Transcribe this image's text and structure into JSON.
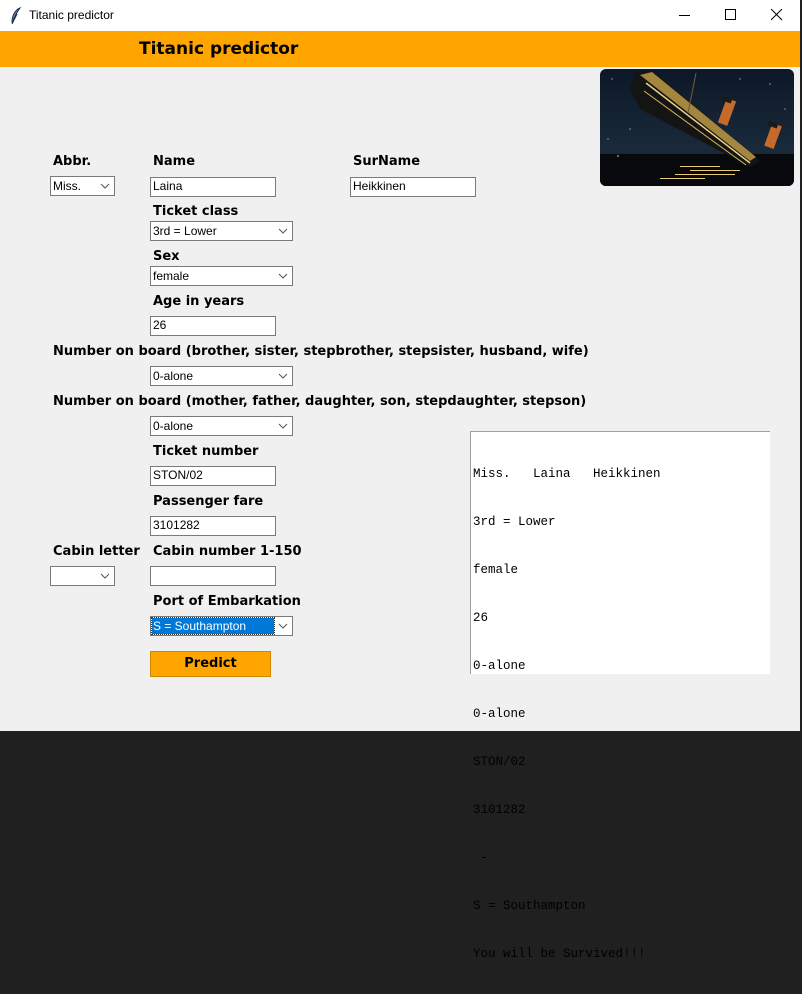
{
  "window": {
    "title": "Titanic predictor",
    "controls": [
      "minimize",
      "maximize",
      "close"
    ]
  },
  "header": {
    "title": "Titanic predictor",
    "color": "#ffa500"
  },
  "image": {
    "description": "Painting of the Titanic sinking at night"
  },
  "form": {
    "abbr": {
      "label": "Abbr.",
      "value": "Miss."
    },
    "name": {
      "label": "Name",
      "value": "Laina"
    },
    "surname": {
      "label": "SurName",
      "value": "Heikkinen"
    },
    "ticket_class": {
      "label": "Ticket class",
      "value": "3rd = Lower"
    },
    "sex": {
      "label": "Sex",
      "value": "female"
    },
    "age": {
      "label": "Age in years",
      "value": "26"
    },
    "sibsp": {
      "label": "Number on board (brother, sister, stepbrother, stepsister, husband, wife)",
      "value": "0-alone"
    },
    "parch": {
      "label": "Number on board (mother, father, daughter, son, stepdaughter, stepson)",
      "value": "0-alone"
    },
    "ticket_number": {
      "label": "Ticket number",
      "value": "STON/02"
    },
    "fare": {
      "label": "Passenger fare",
      "value": "3101282"
    },
    "cabin_letter": {
      "label": "Cabin letter",
      "value": ""
    },
    "cabin_number": {
      "label": "Cabin number 1-150",
      "value": ""
    },
    "embarked": {
      "label": "Port of Embarkation",
      "value": "S = Southampton"
    },
    "predict_label": "Predict"
  },
  "output": {
    "lines": [
      "Miss.   Laina   Heikkinen",
      "3rd = Lower",
      "female",
      "26",
      "0-alone",
      "0-alone",
      "STON/02",
      "3101282",
      " -",
      "S = Southampton",
      "You will be Survived!!!"
    ]
  }
}
